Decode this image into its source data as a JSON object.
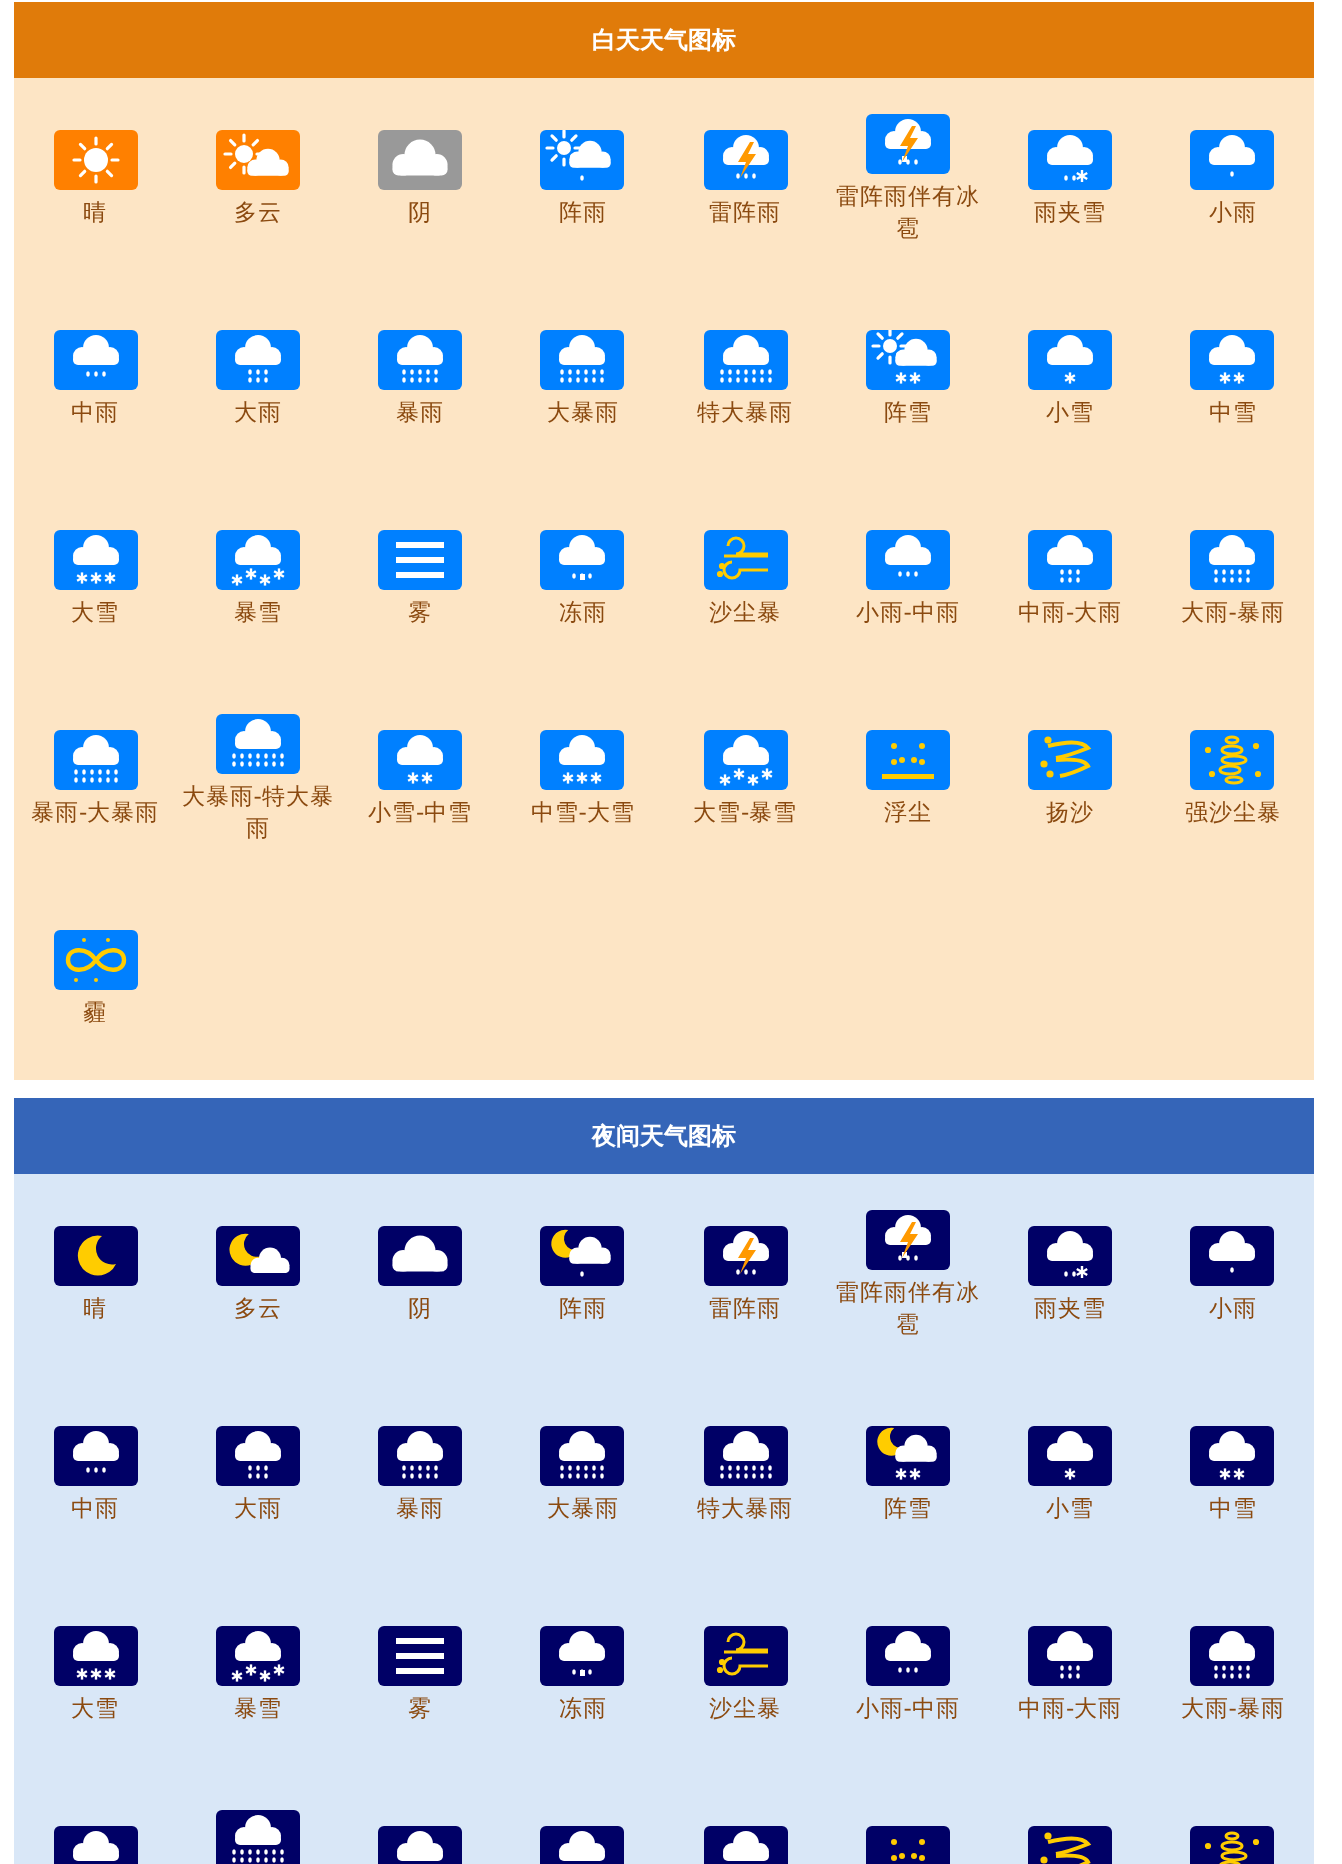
{
  "sections": [
    {
      "title": "白天天气图标",
      "kind": "day",
      "items": [
        {
          "label": "晴",
          "kind": "sun",
          "color": "#ff8000"
        },
        {
          "label": "多云",
          "kind": "sun-cloud",
          "color": "#ff8000"
        },
        {
          "label": "阴",
          "kind": "cloud",
          "color": "#999999"
        },
        {
          "label": "阵雨",
          "kind": "sun-shower",
          "color": "#0080ff"
        },
        {
          "label": "雷阵雨",
          "kind": "thunder",
          "color": "#0080ff"
        },
        {
          "label": "雷阵雨伴有冰雹",
          "kind": "thunder-hail",
          "color": "#0080ff"
        },
        {
          "label": "雨夹雪",
          "kind": "sleet",
          "color": "#0080ff"
        },
        {
          "label": "小雨",
          "kind": "rain-1",
          "color": "#0080ff"
        },
        {
          "label": "中雨",
          "kind": "rain-2",
          "color": "#0080ff"
        },
        {
          "label": "大雨",
          "kind": "rain-3",
          "color": "#0080ff"
        },
        {
          "label": "暴雨",
          "kind": "rain-4",
          "color": "#0080ff"
        },
        {
          "label": "大暴雨",
          "kind": "rain-5",
          "color": "#0080ff"
        },
        {
          "label": "特大暴雨",
          "kind": "rain-6",
          "color": "#0080ff"
        },
        {
          "label": "阵雪",
          "kind": "sun-snow",
          "color": "#0080ff"
        },
        {
          "label": "小雪",
          "kind": "snow-1",
          "color": "#0080ff"
        },
        {
          "label": "中雪",
          "kind": "snow-2",
          "color": "#0080ff"
        },
        {
          "label": "大雪",
          "kind": "snow-3",
          "color": "#0080ff"
        },
        {
          "label": "暴雪",
          "kind": "snow-4",
          "color": "#0080ff"
        },
        {
          "label": "雾",
          "kind": "fog",
          "color": "#0080ff"
        },
        {
          "label": "冻雨",
          "kind": "freezing-rain",
          "color": "#0080ff"
        },
        {
          "label": "沙尘暴",
          "kind": "sandstorm",
          "color": "#0080ff"
        },
        {
          "label": "小雨-中雨",
          "kind": "rain-2",
          "color": "#0080ff"
        },
        {
          "label": "中雨-大雨",
          "kind": "rain-3",
          "color": "#0080ff"
        },
        {
          "label": "大雨-暴雨",
          "kind": "rain-4",
          "color": "#0080ff"
        },
        {
          "label": "暴雨-大暴雨",
          "kind": "rain-5",
          "color": "#0080ff"
        },
        {
          "label": "大暴雨-特大暴雨",
          "kind": "rain-6",
          "color": "#0080ff"
        },
        {
          "label": "小雪-中雪",
          "kind": "snow-2",
          "color": "#0080ff"
        },
        {
          "label": "中雪-大雪",
          "kind": "snow-3",
          "color": "#0080ff"
        },
        {
          "label": "大雪-暴雪",
          "kind": "snow-4",
          "color": "#0080ff"
        },
        {
          "label": "浮尘",
          "kind": "dust",
          "color": "#0080ff"
        },
        {
          "label": "扬沙",
          "kind": "blowing-sand",
          "color": "#0080ff"
        },
        {
          "label": "强沙尘暴",
          "kind": "strong-sandstorm",
          "color": "#0080ff"
        },
        {
          "label": "霾",
          "kind": "haze",
          "color": "#0080ff"
        }
      ]
    },
    {
      "title": "夜间天气图标",
      "kind": "night",
      "items": [
        {
          "label": "晴",
          "kind": "moon",
          "color": "#000066"
        },
        {
          "label": "多云",
          "kind": "moon-cloud",
          "color": "#000066"
        },
        {
          "label": "阴",
          "kind": "cloud",
          "color": "#000066"
        },
        {
          "label": "阵雨",
          "kind": "moon-shower",
          "color": "#000066"
        },
        {
          "label": "雷阵雨",
          "kind": "thunder",
          "color": "#000066"
        },
        {
          "label": "雷阵雨伴有冰雹",
          "kind": "thunder-hail",
          "color": "#000066"
        },
        {
          "label": "雨夹雪",
          "kind": "sleet",
          "color": "#000066"
        },
        {
          "label": "小雨",
          "kind": "rain-1",
          "color": "#000066"
        },
        {
          "label": "中雨",
          "kind": "rain-2",
          "color": "#000066"
        },
        {
          "label": "大雨",
          "kind": "rain-3",
          "color": "#000066"
        },
        {
          "label": "暴雨",
          "kind": "rain-4",
          "color": "#000066"
        },
        {
          "label": "大暴雨",
          "kind": "rain-5",
          "color": "#000066"
        },
        {
          "label": "特大暴雨",
          "kind": "rain-6",
          "color": "#000066"
        },
        {
          "label": "阵雪",
          "kind": "moon-snow",
          "color": "#000066"
        },
        {
          "label": "小雪",
          "kind": "snow-1",
          "color": "#000066"
        },
        {
          "label": "中雪",
          "kind": "snow-2",
          "color": "#000066"
        },
        {
          "label": "大雪",
          "kind": "snow-3",
          "color": "#000066"
        },
        {
          "label": "暴雪",
          "kind": "snow-4",
          "color": "#000066"
        },
        {
          "label": "雾",
          "kind": "fog",
          "color": "#000066"
        },
        {
          "label": "冻雨",
          "kind": "freezing-rain",
          "color": "#000066"
        },
        {
          "label": "沙尘暴",
          "kind": "sandstorm",
          "color": "#000066"
        },
        {
          "label": "小雨-中雨",
          "kind": "rain-2",
          "color": "#000066"
        },
        {
          "label": "中雨-大雨",
          "kind": "rain-3",
          "color": "#000066"
        },
        {
          "label": "大雨-暴雨",
          "kind": "rain-4",
          "color": "#000066"
        },
        {
          "kind": "rain-5",
          "color": "#000066"
        },
        {
          "kind": "rain-6",
          "color": "#000066",
          "tall": true
        },
        {
          "kind": "snow-2",
          "color": "#000066"
        },
        {
          "kind": "snow-3",
          "color": "#000066"
        },
        {
          "kind": "snow-4",
          "color": "#000066"
        },
        {
          "kind": "dust",
          "color": "#000066"
        },
        {
          "kind": "blowing-sand",
          "color": "#000066"
        },
        {
          "kind": "strong-sandstorm",
          "color": "#000066"
        }
      ]
    }
  ]
}
